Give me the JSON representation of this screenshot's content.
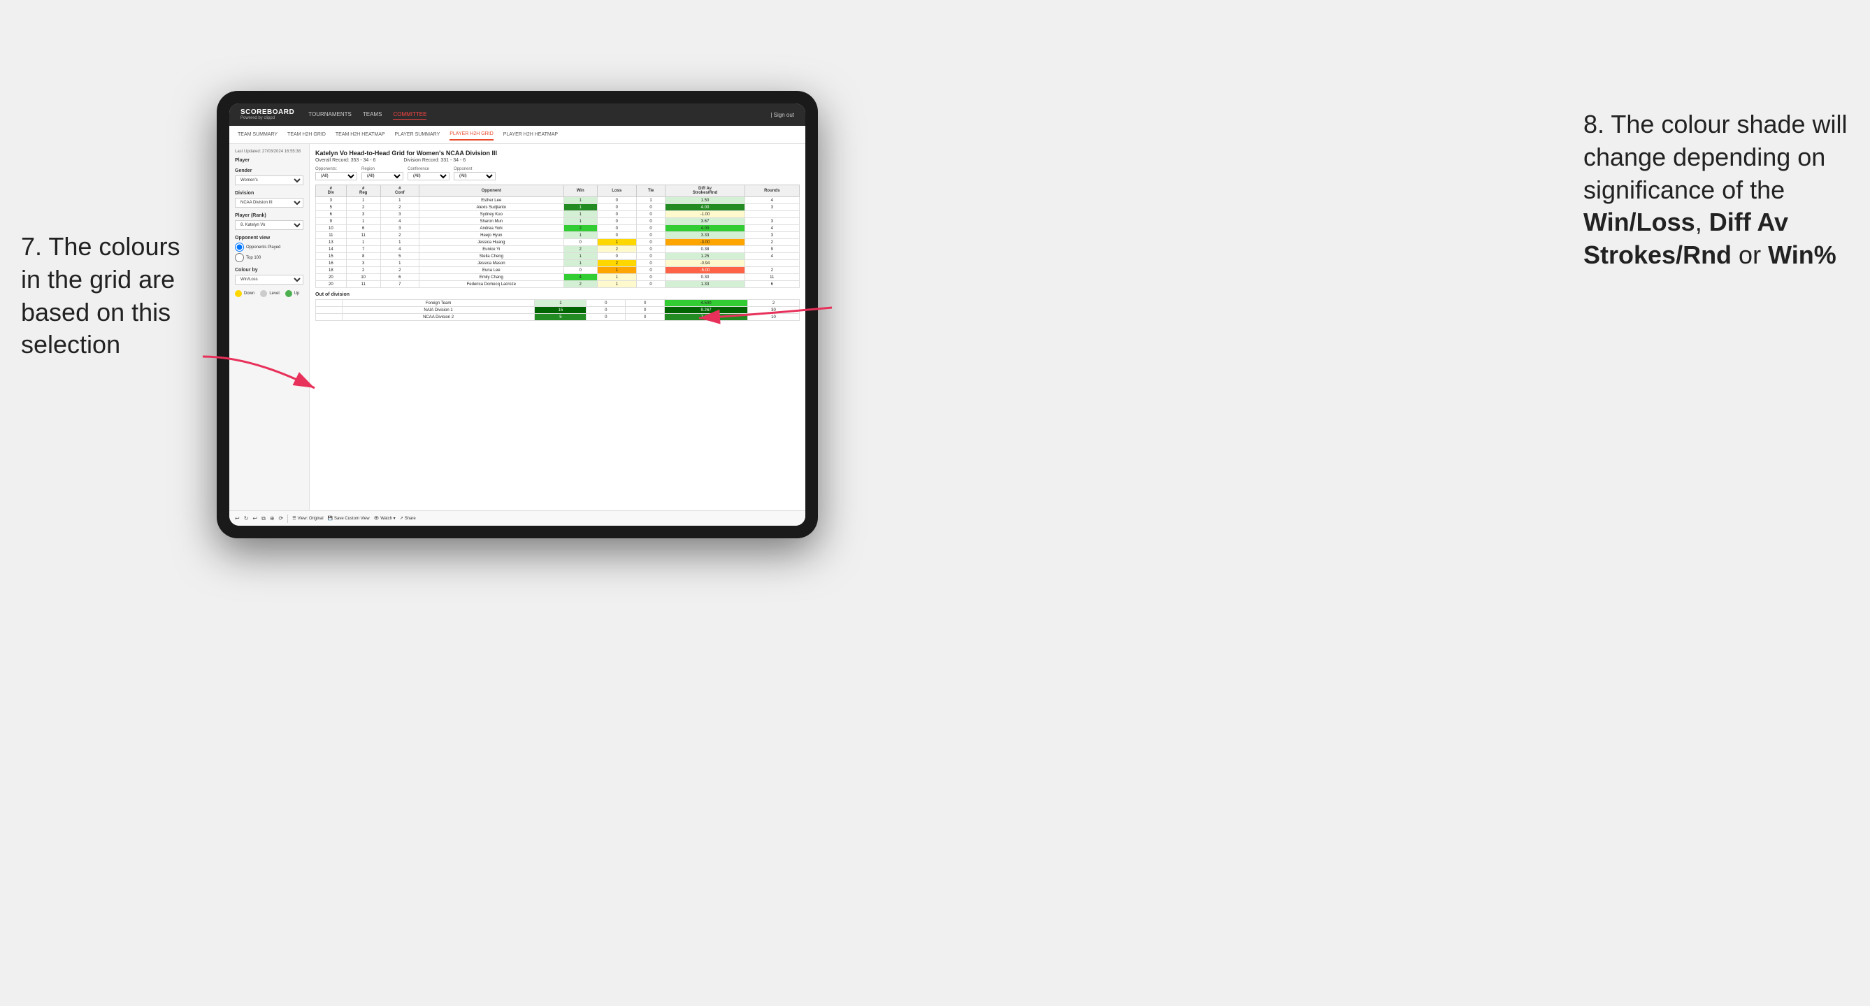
{
  "annotations": {
    "left_text": "7. The colours in the grid are based on this selection",
    "right_text_1": "8. The colour shade will change depending on significance of the ",
    "right_bold_1": "Win/Loss",
    "right_text_2": ", ",
    "right_bold_2": "Diff Av Strokes/Rnd",
    "right_text_3": " or ",
    "right_bold_3": "Win%"
  },
  "tablet": {
    "nav": {
      "logo": "SCOREBOARD",
      "logo_sub": "Powered by clippd",
      "items": [
        "TOURNAMENTS",
        "TEAMS",
        "COMMITTEE"
      ],
      "sign_in": "| Sign out"
    },
    "sub_nav": {
      "items": [
        "TEAM SUMMARY",
        "TEAM H2H GRID",
        "TEAM H2H HEATMAP",
        "PLAYER SUMMARY",
        "PLAYER H2H GRID",
        "PLAYER H2H HEATMAP"
      ]
    },
    "sidebar": {
      "timestamp": "Last Updated: 27/03/2024 16:55:38",
      "player_label": "Player",
      "gender_label": "Gender",
      "gender_value": "Women's",
      "division_label": "Division",
      "division_value": "NCAA Division III",
      "player_rank_label": "Player (Rank)",
      "player_rank_value": "8. Katelyn Vo",
      "opponent_view_label": "Opponent view",
      "radio_opponents": "Opponents Played",
      "radio_top100": "Top 100",
      "colour_by_label": "Colour by",
      "colour_by_value": "Win/Loss"
    },
    "grid": {
      "title": "Katelyn Vo Head-to-Head Grid for Women's NCAA Division III",
      "overall_record_label": "Overall Record:",
      "overall_record": "353 - 34 - 6",
      "division_record_label": "Division Record:",
      "division_record": "331 - 34 - 6",
      "filters": {
        "opponents_label": "Opponents:",
        "opponents_value": "(All)",
        "region_label": "Region",
        "region_value": "(All)",
        "conference_label": "Conference",
        "conference_value": "(All)",
        "opponent_label": "Opponent",
        "opponent_value": "(All)"
      },
      "table_headers": [
        "#\nDiv",
        "#\nReg",
        "#\nConf",
        "Opponent",
        "Win",
        "Loss",
        "Tie",
        "Diff Av\nStrokes/Rnd",
        "Rounds"
      ],
      "rows": [
        {
          "div": 3,
          "reg": 1,
          "conf": 1,
          "name": "Esther Lee",
          "win": 1,
          "loss": 0,
          "tie": 1,
          "diff": 1.5,
          "rounds": 4,
          "win_color": "green_light",
          "loss_color": "neutral",
          "diff_color": "green_light"
        },
        {
          "div": 5,
          "reg": 2,
          "conf": 2,
          "name": "Alexis Sudjianto",
          "win": 1,
          "loss": 0,
          "tie": 0,
          "diff": 4.0,
          "rounds": 3,
          "win_color": "green_dark",
          "loss_color": "neutral",
          "diff_color": "green_dark"
        },
        {
          "div": 6,
          "reg": 3,
          "conf": 3,
          "name": "Sydney Kuo",
          "win": 1,
          "loss": 0,
          "tie": 0,
          "diff": -1.0,
          "rounds": "",
          "win_color": "green_light",
          "loss_color": "neutral",
          "diff_color": "loss_light"
        },
        {
          "div": 9,
          "reg": 1,
          "conf": 4,
          "name": "Sharon Mun",
          "win": 1,
          "loss": 0,
          "tie": 0,
          "diff": 3.67,
          "rounds": 3,
          "win_color": "green_light",
          "loss_color": "neutral",
          "diff_color": "green_light"
        },
        {
          "div": 10,
          "reg": 6,
          "conf": 3,
          "name": "Andrea York",
          "win": 2,
          "loss": 0,
          "tie": 0,
          "diff": 4.0,
          "rounds": 4,
          "win_color": "green_dark",
          "loss_color": "neutral",
          "diff_color": "green_dark"
        },
        {
          "div": 11,
          "reg": 11,
          "conf": 2,
          "name": "Heejo Hyun",
          "win": 1,
          "loss": 0,
          "tie": 0,
          "diff": 3.33,
          "rounds": 3,
          "win_color": "green_light",
          "loss_color": "neutral",
          "diff_color": "green_light"
        },
        {
          "div": 13,
          "reg": 1,
          "conf": 1,
          "name": "Jessica Huang",
          "win": 0,
          "loss": 1,
          "tie": 0,
          "diff": -3.0,
          "rounds": 2,
          "win_color": "neutral",
          "loss_color": "yellow_med",
          "diff_color": "orange_light"
        },
        {
          "div": 14,
          "reg": 7,
          "conf": 4,
          "name": "Eunice Yi",
          "win": 2,
          "loss": 2,
          "tie": 0,
          "diff": 0.38,
          "rounds": 9,
          "win_color": "green_light",
          "loss_color": "yellow_light",
          "diff_color": "neutral"
        },
        {
          "div": 15,
          "reg": 8,
          "conf": 5,
          "name": "Stella Cheng",
          "win": 1,
          "loss": 0,
          "tie": 0,
          "diff": 1.25,
          "rounds": 4,
          "win_color": "green_light",
          "loss_color": "neutral",
          "diff_color": "green_light"
        },
        {
          "div": 16,
          "reg": 3,
          "conf": 1,
          "name": "Jessica Mason",
          "win": 1,
          "loss": 2,
          "tie": 0,
          "diff": -0.94,
          "rounds": "",
          "win_color": "green_light",
          "loss_color": "yellow_med",
          "diff_color": "loss_light"
        },
        {
          "div": 18,
          "reg": 2,
          "conf": 2,
          "name": "Euna Lee",
          "win": 0,
          "loss": 1,
          "tie": 0,
          "diff": -5.0,
          "rounds": 2,
          "win_color": "neutral",
          "loss_color": "orange_med",
          "diff_color": "red_light"
        },
        {
          "div": 20,
          "reg": 10,
          "conf": 6,
          "name": "Emily Chang",
          "win": 4,
          "loss": 1,
          "tie": 0,
          "diff": 0.3,
          "rounds": 11,
          "win_color": "green_dark",
          "loss_color": "yellow_light",
          "diff_color": "neutral"
        },
        {
          "div": 20,
          "reg": 11,
          "conf": 7,
          "name": "Federica Domecq Lacroze",
          "win": 2,
          "loss": 1,
          "tie": 0,
          "diff": 1.33,
          "rounds": 6,
          "win_color": "green_light",
          "loss_color": "yellow_light",
          "diff_color": "green_light"
        }
      ],
      "out_of_division_label": "Out of division",
      "out_of_division_rows": [
        {
          "name": "Foreign Team",
          "win": 1,
          "loss": 0,
          "tie": 0,
          "diff": 4.5,
          "rounds": 2
        },
        {
          "name": "NAIA Division 1",
          "win": 15,
          "loss": 0,
          "tie": 0,
          "diff": 9.267,
          "rounds": 30
        },
        {
          "name": "NCAA Division 2",
          "win": 5,
          "loss": 0,
          "tie": 0,
          "diff": 7.4,
          "rounds": 10
        }
      ]
    },
    "legend": {
      "down_label": "Down",
      "level_label": "Level",
      "up_label": "Up"
    },
    "toolbar": {
      "view_original": "View: Original",
      "save_custom_view": "Save Custom View",
      "watch": "Watch ▾",
      "share": "Share"
    }
  }
}
